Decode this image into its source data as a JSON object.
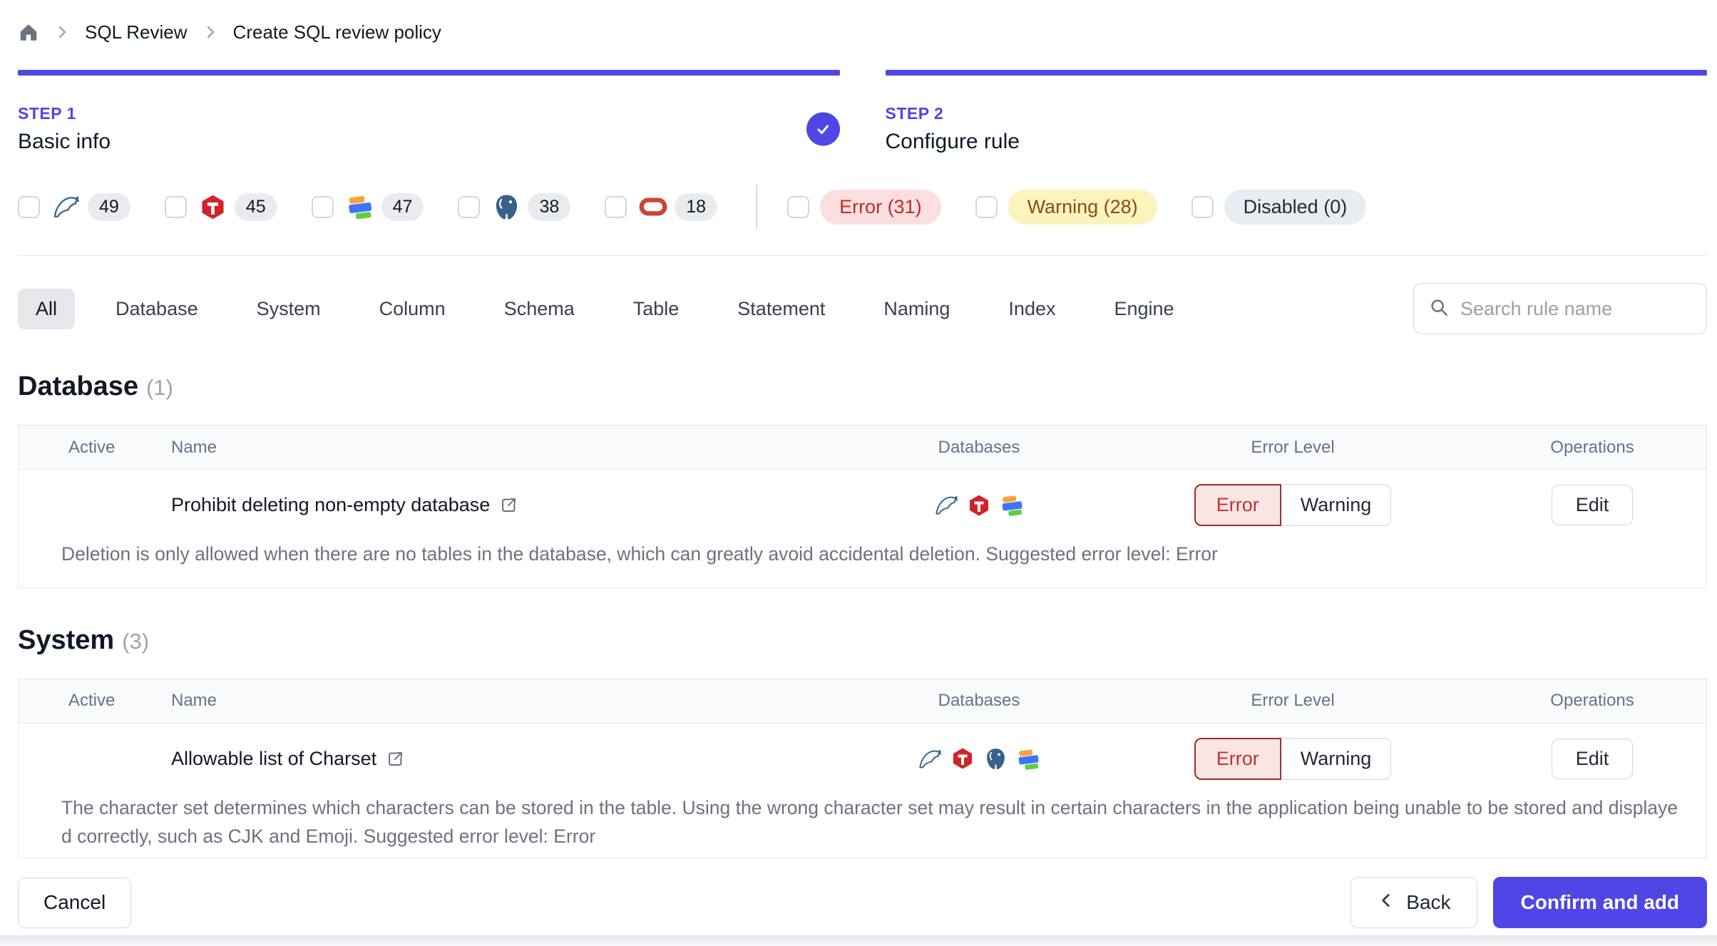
{
  "breadcrumb": {
    "items": [
      "SQL Review",
      "Create SQL review policy"
    ]
  },
  "steps": [
    {
      "step_label": "STEP 1",
      "title": "Basic info",
      "completed": true
    },
    {
      "step_label": "STEP 2",
      "title": "Configure rule",
      "completed": false
    }
  ],
  "filters": {
    "engines": [
      {
        "icon": "mysql-icon",
        "name": "MySQL",
        "count": "49",
        "checked": false
      },
      {
        "icon": "tidb-icon",
        "name": "TiDB",
        "count": "45",
        "checked": false
      },
      {
        "icon": "oceanbase-icon",
        "name": "OceanBase",
        "count": "47",
        "checked": false
      },
      {
        "icon": "postgresql-icon",
        "name": "PostgreSQL",
        "count": "38",
        "checked": false
      },
      {
        "icon": "oracle-icon",
        "name": "Oracle",
        "count": "18",
        "checked": false
      }
    ],
    "levels": [
      {
        "label": "Error (31)",
        "bg": "#fbdfdf",
        "text": "#c22a2a",
        "checked": false
      },
      {
        "label": "Warning (28)",
        "bg": "#fcf3bd",
        "text": "#8a4b12",
        "checked": false
      },
      {
        "label": "Disabled (0)",
        "bg": "#e9edf2",
        "text": "#1f2937",
        "checked": false
      }
    ]
  },
  "tabs": {
    "items": [
      "All",
      "Database",
      "System",
      "Column",
      "Schema",
      "Table",
      "Statement",
      "Naming",
      "Index",
      "Engine"
    ],
    "active": "All"
  },
  "search": {
    "placeholder": "Search rule name"
  },
  "table_headers": {
    "active": "Active",
    "name": "Name",
    "databases": "Databases",
    "error_level": "Error Level",
    "operations": "Operations"
  },
  "sections": [
    {
      "title": "Database",
      "count": "(1)",
      "rules": [
        {
          "name": "Prohibit deleting non-empty database",
          "active": true,
          "engines": [
            "mysql-icon",
            "tidb-icon",
            "oceanbase-icon"
          ],
          "level_options": [
            "Error",
            "Warning"
          ],
          "selected_level": "Error",
          "edit_label": "Edit",
          "description": "Deletion is only allowed when there are no tables in the database, which can greatly avoid accidental deletion. Suggested error level: Error"
        }
      ]
    },
    {
      "title": "System",
      "count": "(3)",
      "rules": [
        {
          "name": "Allowable list of Charset",
          "active": true,
          "engines": [
            "mysql-icon",
            "tidb-icon",
            "postgresql-icon",
            "oceanbase-icon"
          ],
          "level_options": [
            "Error",
            "Warning"
          ],
          "selected_level": "Error",
          "edit_label": "Edit",
          "description": "The character set determines which characters can be stored in the table. Using the wrong character set may result in certain characters in the application being unable to be stored and displayed correctly, such as CJK and Emoji. Suggested error level: Error"
        }
      ]
    }
  ],
  "footer": {
    "cancel": "Cancel",
    "back": "Back",
    "confirm": "Confirm and add"
  },
  "colors": {
    "accent": "#4f46e5",
    "error_red": "#bf3430",
    "warning_yellow": "#fcf3bd",
    "border_gray": "#e5e7eb"
  }
}
